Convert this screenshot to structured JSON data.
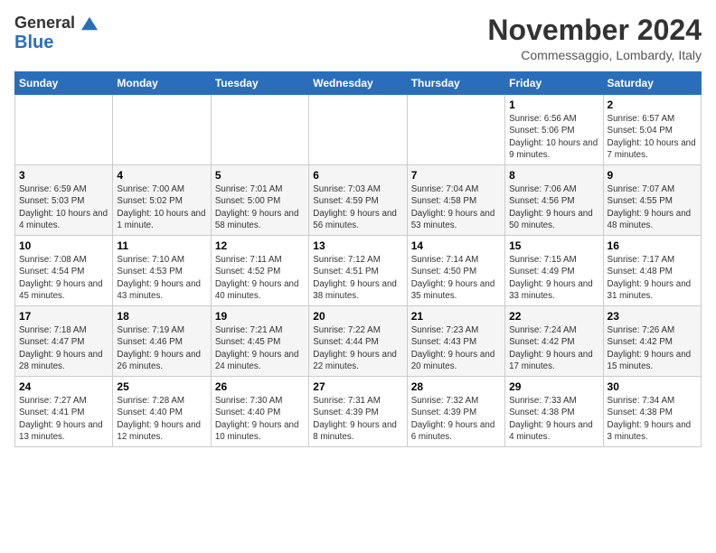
{
  "logo": {
    "line1": "General",
    "line2": "Blue"
  },
  "title": "November 2024",
  "location": "Commessaggio, Lombardy, Italy",
  "days_of_week": [
    "Sunday",
    "Monday",
    "Tuesday",
    "Wednesday",
    "Thursday",
    "Friday",
    "Saturday"
  ],
  "weeks": [
    [
      {
        "day": "",
        "info": ""
      },
      {
        "day": "",
        "info": ""
      },
      {
        "day": "",
        "info": ""
      },
      {
        "day": "",
        "info": ""
      },
      {
        "day": "",
        "info": ""
      },
      {
        "day": "1",
        "info": "Sunrise: 6:56 AM\nSunset: 5:06 PM\nDaylight: 10 hours and 9 minutes."
      },
      {
        "day": "2",
        "info": "Sunrise: 6:57 AM\nSunset: 5:04 PM\nDaylight: 10 hours and 7 minutes."
      }
    ],
    [
      {
        "day": "3",
        "info": "Sunrise: 6:59 AM\nSunset: 5:03 PM\nDaylight: 10 hours and 4 minutes."
      },
      {
        "day": "4",
        "info": "Sunrise: 7:00 AM\nSunset: 5:02 PM\nDaylight: 10 hours and 1 minute."
      },
      {
        "day": "5",
        "info": "Sunrise: 7:01 AM\nSunset: 5:00 PM\nDaylight: 9 hours and 58 minutes."
      },
      {
        "day": "6",
        "info": "Sunrise: 7:03 AM\nSunset: 4:59 PM\nDaylight: 9 hours and 56 minutes."
      },
      {
        "day": "7",
        "info": "Sunrise: 7:04 AM\nSunset: 4:58 PM\nDaylight: 9 hours and 53 minutes."
      },
      {
        "day": "8",
        "info": "Sunrise: 7:06 AM\nSunset: 4:56 PM\nDaylight: 9 hours and 50 minutes."
      },
      {
        "day": "9",
        "info": "Sunrise: 7:07 AM\nSunset: 4:55 PM\nDaylight: 9 hours and 48 minutes."
      }
    ],
    [
      {
        "day": "10",
        "info": "Sunrise: 7:08 AM\nSunset: 4:54 PM\nDaylight: 9 hours and 45 minutes."
      },
      {
        "day": "11",
        "info": "Sunrise: 7:10 AM\nSunset: 4:53 PM\nDaylight: 9 hours and 43 minutes."
      },
      {
        "day": "12",
        "info": "Sunrise: 7:11 AM\nSunset: 4:52 PM\nDaylight: 9 hours and 40 minutes."
      },
      {
        "day": "13",
        "info": "Sunrise: 7:12 AM\nSunset: 4:51 PM\nDaylight: 9 hours and 38 minutes."
      },
      {
        "day": "14",
        "info": "Sunrise: 7:14 AM\nSunset: 4:50 PM\nDaylight: 9 hours and 35 minutes."
      },
      {
        "day": "15",
        "info": "Sunrise: 7:15 AM\nSunset: 4:49 PM\nDaylight: 9 hours and 33 minutes."
      },
      {
        "day": "16",
        "info": "Sunrise: 7:17 AM\nSunset: 4:48 PM\nDaylight: 9 hours and 31 minutes."
      }
    ],
    [
      {
        "day": "17",
        "info": "Sunrise: 7:18 AM\nSunset: 4:47 PM\nDaylight: 9 hours and 28 minutes."
      },
      {
        "day": "18",
        "info": "Sunrise: 7:19 AM\nSunset: 4:46 PM\nDaylight: 9 hours and 26 minutes."
      },
      {
        "day": "19",
        "info": "Sunrise: 7:21 AM\nSunset: 4:45 PM\nDaylight: 9 hours and 24 minutes."
      },
      {
        "day": "20",
        "info": "Sunrise: 7:22 AM\nSunset: 4:44 PM\nDaylight: 9 hours and 22 minutes."
      },
      {
        "day": "21",
        "info": "Sunrise: 7:23 AM\nSunset: 4:43 PM\nDaylight: 9 hours and 20 minutes."
      },
      {
        "day": "22",
        "info": "Sunrise: 7:24 AM\nSunset: 4:42 PM\nDaylight: 9 hours and 17 minutes."
      },
      {
        "day": "23",
        "info": "Sunrise: 7:26 AM\nSunset: 4:42 PM\nDaylight: 9 hours and 15 minutes."
      }
    ],
    [
      {
        "day": "24",
        "info": "Sunrise: 7:27 AM\nSunset: 4:41 PM\nDaylight: 9 hours and 13 minutes."
      },
      {
        "day": "25",
        "info": "Sunrise: 7:28 AM\nSunset: 4:40 PM\nDaylight: 9 hours and 12 minutes."
      },
      {
        "day": "26",
        "info": "Sunrise: 7:30 AM\nSunset: 4:40 PM\nDaylight: 9 hours and 10 minutes."
      },
      {
        "day": "27",
        "info": "Sunrise: 7:31 AM\nSunset: 4:39 PM\nDaylight: 9 hours and 8 minutes."
      },
      {
        "day": "28",
        "info": "Sunrise: 7:32 AM\nSunset: 4:39 PM\nDaylight: 9 hours and 6 minutes."
      },
      {
        "day": "29",
        "info": "Sunrise: 7:33 AM\nSunset: 4:38 PM\nDaylight: 9 hours and 4 minutes."
      },
      {
        "day": "30",
        "info": "Sunrise: 7:34 AM\nSunset: 4:38 PM\nDaylight: 9 hours and 3 minutes."
      }
    ]
  ]
}
